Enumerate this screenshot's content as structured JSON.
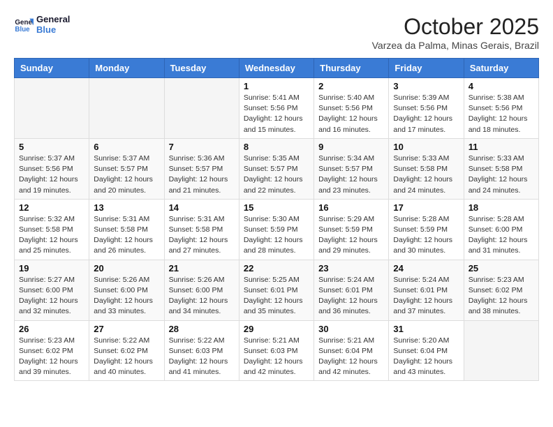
{
  "logo": {
    "line1": "General",
    "line2": "Blue"
  },
  "title": "October 2025",
  "subtitle": "Varzea da Palma, Minas Gerais, Brazil",
  "days_of_week": [
    "Sunday",
    "Monday",
    "Tuesday",
    "Wednesday",
    "Thursday",
    "Friday",
    "Saturday"
  ],
  "weeks": [
    [
      {
        "day": "",
        "info": ""
      },
      {
        "day": "",
        "info": ""
      },
      {
        "day": "",
        "info": ""
      },
      {
        "day": "1",
        "info": "Sunrise: 5:41 AM\nSunset: 5:56 PM\nDaylight: 12 hours\nand 15 minutes."
      },
      {
        "day": "2",
        "info": "Sunrise: 5:40 AM\nSunset: 5:56 PM\nDaylight: 12 hours\nand 16 minutes."
      },
      {
        "day": "3",
        "info": "Sunrise: 5:39 AM\nSunset: 5:56 PM\nDaylight: 12 hours\nand 17 minutes."
      },
      {
        "day": "4",
        "info": "Sunrise: 5:38 AM\nSunset: 5:56 PM\nDaylight: 12 hours\nand 18 minutes."
      }
    ],
    [
      {
        "day": "5",
        "info": "Sunrise: 5:37 AM\nSunset: 5:56 PM\nDaylight: 12 hours\nand 19 minutes."
      },
      {
        "day": "6",
        "info": "Sunrise: 5:37 AM\nSunset: 5:57 PM\nDaylight: 12 hours\nand 20 minutes."
      },
      {
        "day": "7",
        "info": "Sunrise: 5:36 AM\nSunset: 5:57 PM\nDaylight: 12 hours\nand 21 minutes."
      },
      {
        "day": "8",
        "info": "Sunrise: 5:35 AM\nSunset: 5:57 PM\nDaylight: 12 hours\nand 22 minutes."
      },
      {
        "day": "9",
        "info": "Sunrise: 5:34 AM\nSunset: 5:57 PM\nDaylight: 12 hours\nand 23 minutes."
      },
      {
        "day": "10",
        "info": "Sunrise: 5:33 AM\nSunset: 5:58 PM\nDaylight: 12 hours\nand 24 minutes."
      },
      {
        "day": "11",
        "info": "Sunrise: 5:33 AM\nSunset: 5:58 PM\nDaylight: 12 hours\nand 24 minutes."
      }
    ],
    [
      {
        "day": "12",
        "info": "Sunrise: 5:32 AM\nSunset: 5:58 PM\nDaylight: 12 hours\nand 25 minutes."
      },
      {
        "day": "13",
        "info": "Sunrise: 5:31 AM\nSunset: 5:58 PM\nDaylight: 12 hours\nand 26 minutes."
      },
      {
        "day": "14",
        "info": "Sunrise: 5:31 AM\nSunset: 5:58 PM\nDaylight: 12 hours\nand 27 minutes."
      },
      {
        "day": "15",
        "info": "Sunrise: 5:30 AM\nSunset: 5:59 PM\nDaylight: 12 hours\nand 28 minutes."
      },
      {
        "day": "16",
        "info": "Sunrise: 5:29 AM\nSunset: 5:59 PM\nDaylight: 12 hours\nand 29 minutes."
      },
      {
        "day": "17",
        "info": "Sunrise: 5:28 AM\nSunset: 5:59 PM\nDaylight: 12 hours\nand 30 minutes."
      },
      {
        "day": "18",
        "info": "Sunrise: 5:28 AM\nSunset: 6:00 PM\nDaylight: 12 hours\nand 31 minutes."
      }
    ],
    [
      {
        "day": "19",
        "info": "Sunrise: 5:27 AM\nSunset: 6:00 PM\nDaylight: 12 hours\nand 32 minutes."
      },
      {
        "day": "20",
        "info": "Sunrise: 5:26 AM\nSunset: 6:00 PM\nDaylight: 12 hours\nand 33 minutes."
      },
      {
        "day": "21",
        "info": "Sunrise: 5:26 AM\nSunset: 6:00 PM\nDaylight: 12 hours\nand 34 minutes."
      },
      {
        "day": "22",
        "info": "Sunrise: 5:25 AM\nSunset: 6:01 PM\nDaylight: 12 hours\nand 35 minutes."
      },
      {
        "day": "23",
        "info": "Sunrise: 5:24 AM\nSunset: 6:01 PM\nDaylight: 12 hours\nand 36 minutes."
      },
      {
        "day": "24",
        "info": "Sunrise: 5:24 AM\nSunset: 6:01 PM\nDaylight: 12 hours\nand 37 minutes."
      },
      {
        "day": "25",
        "info": "Sunrise: 5:23 AM\nSunset: 6:02 PM\nDaylight: 12 hours\nand 38 minutes."
      }
    ],
    [
      {
        "day": "26",
        "info": "Sunrise: 5:23 AM\nSunset: 6:02 PM\nDaylight: 12 hours\nand 39 minutes."
      },
      {
        "day": "27",
        "info": "Sunrise: 5:22 AM\nSunset: 6:02 PM\nDaylight: 12 hours\nand 40 minutes."
      },
      {
        "day": "28",
        "info": "Sunrise: 5:22 AM\nSunset: 6:03 PM\nDaylight: 12 hours\nand 41 minutes."
      },
      {
        "day": "29",
        "info": "Sunrise: 5:21 AM\nSunset: 6:03 PM\nDaylight: 12 hours\nand 42 minutes."
      },
      {
        "day": "30",
        "info": "Sunrise: 5:21 AM\nSunset: 6:04 PM\nDaylight: 12 hours\nand 42 minutes."
      },
      {
        "day": "31",
        "info": "Sunrise: 5:20 AM\nSunset: 6:04 PM\nDaylight: 12 hours\nand 43 minutes."
      },
      {
        "day": "",
        "info": ""
      }
    ]
  ]
}
